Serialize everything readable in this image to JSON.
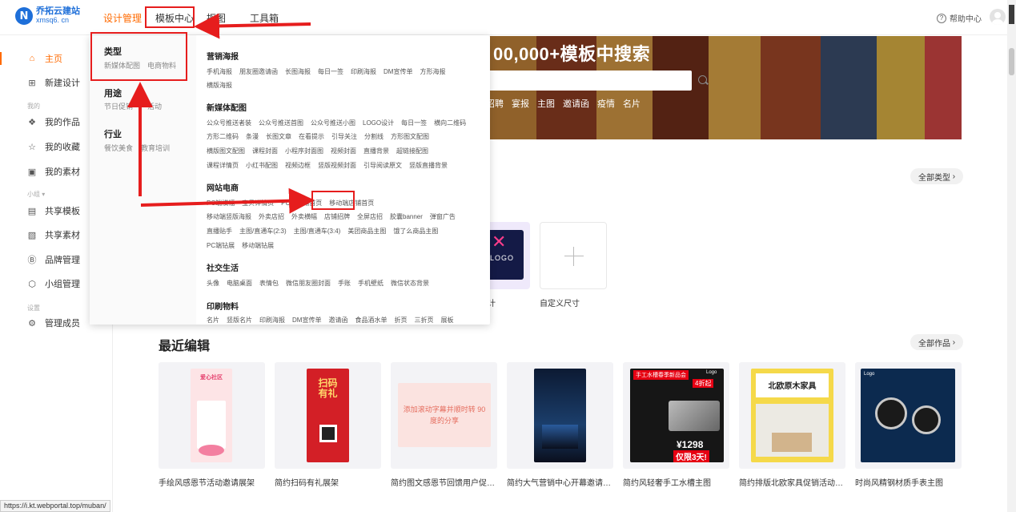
{
  "brand": {
    "name": "乔拓云建站",
    "domain": "xmsq6. cn",
    "logo_letter": "N"
  },
  "topnav": [
    {
      "label": "设计管理",
      "active": true
    },
    {
      "label": "模板中心",
      "active": false
    },
    {
      "label": "抠图",
      "active": false
    },
    {
      "label": "工具箱",
      "active": false
    }
  ],
  "help": {
    "label": "帮助中心"
  },
  "sidebar": {
    "items": [
      {
        "label": "主页",
        "icon": "home-icon",
        "active": true
      },
      {
        "label": "新建设计",
        "icon": "new-doc-icon"
      },
      {
        "group": "我的"
      },
      {
        "label": "我的作品",
        "icon": "works-icon"
      },
      {
        "label": "我的收藏",
        "icon": "star-icon"
      },
      {
        "label": "我的素材",
        "icon": "image-icon"
      },
      {
        "group": "小组"
      },
      {
        "label": "共享模板",
        "icon": "layout-icon"
      },
      {
        "label": "共享素材",
        "icon": "picture-icon"
      },
      {
        "label": "品牌管理",
        "icon": "brand-icon"
      },
      {
        "label": "小组管理",
        "icon": "group-icon"
      },
      {
        "group": "设置"
      },
      {
        "label": "管理成员",
        "icon": "settings-icon"
      }
    ]
  },
  "hero": {
    "title": "00,000+模板中搜索",
    "tags": [
      "招聘",
      "宴报",
      "主图",
      "邀请函",
      "疫情",
      "名片"
    ]
  },
  "dropdown": {
    "types": [
      {
        "title": "类型",
        "items": [
          "新媒体配图",
          "电商物料"
        ]
      },
      {
        "title": "用途",
        "items": [
          "节日促销",
          "活动"
        ]
      },
      {
        "title": "行业",
        "items": [
          "餐饮美食",
          "教育培训"
        ]
      }
    ],
    "categories": [
      {
        "title": "营销海报",
        "links": [
          [
            "手机海报",
            "朋友圈邀请函",
            "长图海报",
            "每日一签",
            "印刷海报",
            "DM宣传单",
            "方形海报"
          ],
          [
            "横版海报"
          ]
        ]
      },
      {
        "title": "新媒体配图",
        "links": [
          [
            "公众号推送者装",
            "公众号推送首图",
            "公众号推送小图",
            "LOGO设计",
            "每日一签",
            "横向二维码"
          ],
          [
            "方形二维码",
            "条漫",
            "长图文章",
            "在看提示",
            "引导关注",
            "分割线",
            "方形图文配图"
          ],
          [
            "横版图文配图",
            "课程封面",
            "小程序封面图",
            "视频封面",
            "直播背景",
            "超链接配图"
          ],
          [
            "课程详情页",
            "小红书配图",
            "视频边框",
            "竖版视频封面",
            "引导阅读原文",
            "竖版直播背景"
          ]
        ]
      },
      {
        "title": "网站电商",
        "links": [
          [
            "PC端横幅",
            "宝贝详情页",
            "PC端店铺首页",
            "移动端店铺首页"
          ],
          [
            "移动端竖版海报",
            "外卖店招",
            "外卖横幅",
            "店铺招牌",
            "全屏店招",
            "胶囊banner",
            "弹窗广告"
          ],
          [
            "直播贴手",
            "主图/直通车(2:3)",
            "主图/直通车(3:4)",
            "美团商品主图",
            "饿了么商品主图"
          ],
          [
            "PC端钻展",
            "移动端钻展"
          ]
        ]
      },
      {
        "title": "社交生活",
        "links": [
          [
            "头像",
            "电脑桌面",
            "表情包",
            "微信朋友圈封面",
            "手账",
            "手机壁纸",
            "微信状态背景"
          ]
        ]
      },
      {
        "title": "印刷物料",
        "links": [
          [
            "名片",
            "竖版名片",
            "印刷海报",
            "DM宣传单",
            "邀请函",
            "食品酒水单",
            "折页",
            "三折页",
            "展板"
          ]
        ]
      }
    ]
  },
  "all_types_button": "全部类型",
  "logo_card": {
    "word": "LOGO",
    "label": "计"
  },
  "custom_size": {
    "label": "自定义尺寸"
  },
  "recent": {
    "title": "最近编辑",
    "all_button": "全部作品",
    "cards": [
      {
        "name": "手绘风感恩节活动邀请展架"
      },
      {
        "name": "简约扫码有礼展架"
      },
      {
        "name": "简约图文感恩节回馈用户促销优..."
      },
      {
        "name": "简约大气营销中心开幕邀请函手..."
      },
      {
        "name": "简约风轻奢手工水槽主图"
      },
      {
        "name": "简约排版北欧家具促销活动移动..."
      },
      {
        "name": "时尚风精钢材质手表主图"
      }
    ]
  },
  "thumb_text": {
    "poster1": "爱心社区",
    "poster2": "扫码有礼",
    "banner3": "添加滚动字幕并顺时转 90度的分享",
    "sink": "手工水槽春季新品会",
    "sink_price": "¥1298",
    "sink_tag": "仅限3天!",
    "furniture": "北欧原木家具",
    "watch_logo": "Logo",
    "sink_logo": "Logo",
    "hint": "4折起"
  },
  "status_url": "https://i.kt.webportal.top/muban/",
  "colors": {
    "accent": "#ff6a00",
    "annotation": "#e61d1d",
    "brand": "#1e6fd9"
  }
}
